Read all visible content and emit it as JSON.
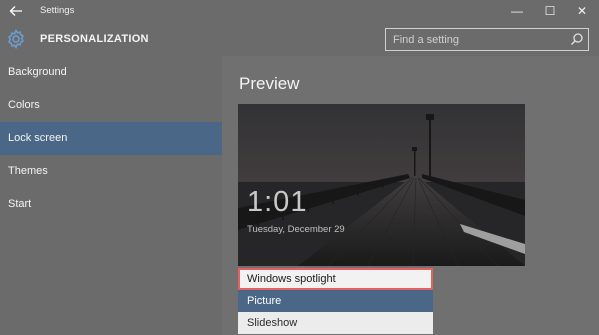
{
  "window": {
    "title": "Settings",
    "back_icon": "back-arrow-icon",
    "minimize_glyph": "—",
    "maximize_glyph": "☐",
    "close_glyph": "✕"
  },
  "header": {
    "icon": "gear-icon",
    "title": "PERSONALIZATION",
    "search_placeholder": "Find a setting",
    "search_value": ""
  },
  "sidebar": {
    "items": [
      {
        "label": "Background",
        "active": false
      },
      {
        "label": "Colors",
        "active": false
      },
      {
        "label": "Lock screen",
        "active": true
      },
      {
        "label": "Themes",
        "active": false
      },
      {
        "label": "Start",
        "active": false
      }
    ]
  },
  "main": {
    "section_title": "Preview",
    "preview": {
      "time": "1:01",
      "date": "Tuesday, December 29"
    },
    "background_dropdown": {
      "options": [
        {
          "label": "Windows spotlight",
          "state": "selected"
        },
        {
          "label": "Picture",
          "state": "highlighted"
        },
        {
          "label": "Slideshow",
          "state": "normal"
        }
      ]
    }
  },
  "colors": {
    "accent": "#4a6788",
    "selection_border": "#e26262",
    "chrome": "#6b6b6b"
  }
}
